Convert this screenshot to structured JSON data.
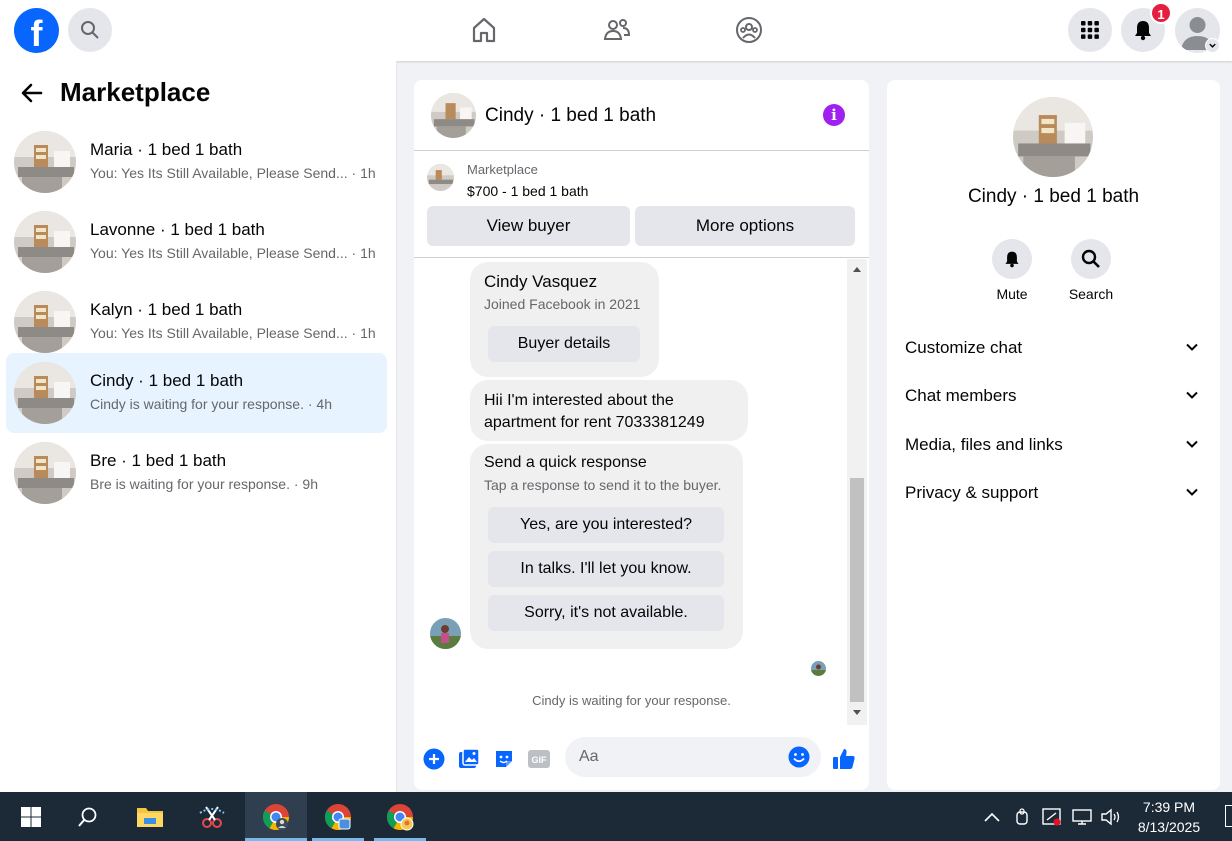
{
  "topbar": {
    "logo_letter": "f",
    "notifications_count": "1",
    "icons": [
      "facebook-logo",
      "search-icon",
      "home-icon",
      "friends-icon",
      "groups-icon",
      "menu-grid-icon",
      "bell-icon",
      "profile-avatar",
      "chevron-down-icon"
    ]
  },
  "sidebar": {
    "title": "Marketplace",
    "conversations": [
      {
        "name": "Maria · 1 bed 1 bath",
        "preview": "You: Yes Its Still Available, Please Send... · 1h"
      },
      {
        "name": "Lavonne · 1 bed 1 bath",
        "preview": "You: Yes Its Still Available, Please Send... · 1h"
      },
      {
        "name": "Kalyn · 1 bed 1 bath",
        "preview": "You: Yes Its Still Available, Please Send... · 1h"
      },
      {
        "name": "Cindy · 1 bed 1 bath",
        "preview": "Cindy is waiting for your response. · 4h",
        "active": true
      },
      {
        "name": "Bre · 1 bed 1 bath",
        "preview": "Bre is waiting for your response. · 9h"
      }
    ]
  },
  "chat": {
    "title": "Cindy · 1 bed 1 bath",
    "listing": {
      "label": "Marketplace",
      "price": "$700 - 1 bed 1 bath"
    },
    "view_buyer": "View buyer",
    "more_options": "More options",
    "buyer_card": {
      "name": "Cindy Vasquez",
      "joined": "Joined Facebook in 2021",
      "button": "Buyer details"
    },
    "message_line1": "Hii I'm interested about the",
    "message_line2": "apartment for rent 7033381249",
    "quick_response": {
      "title": "Send a quick response",
      "subtitle": "Tap a response to send it to the buyer.",
      "options": [
        "Yes, are you interested?",
        "In talks. I'll let you know.",
        "Sorry, it's not available."
      ]
    },
    "waiting": "Cindy is waiting for your response.",
    "input_placeholder": "Aa",
    "composer_icons": [
      "plus-icon",
      "photo-icon",
      "sticker-icon",
      "gif-icon",
      "emoji-icon",
      "thumbs-up-icon"
    ],
    "gif_label": "GIF"
  },
  "right_panel": {
    "title": "Cindy · 1 bed 1 bath",
    "actions": [
      {
        "label": "Mute",
        "icon": "bell-icon"
      },
      {
        "label": "Search",
        "icon": "search-icon"
      }
    ],
    "sections": [
      "Customize chat",
      "Chat members",
      "Media, files and links",
      "Privacy & support"
    ]
  },
  "taskbar": {
    "time": "7:39 PM",
    "date": "8/13/2025",
    "icons": [
      "windows-start-icon",
      "search-icon",
      "file-explorer-icon",
      "snipping-tool-icon",
      "chrome-icon",
      "chrome-icon",
      "chrome-icon"
    ],
    "tray_icons": [
      "chevron-up-icon",
      "meet-icon",
      "network-alert-icon",
      "display-icon",
      "volume-icon"
    ],
    "accent_color": "#76b9ed"
  },
  "colors": {
    "brand": "#0866ff",
    "active_conv": "#e7f3ff",
    "badge": "#e41e3f",
    "info": "#a020f0"
  }
}
